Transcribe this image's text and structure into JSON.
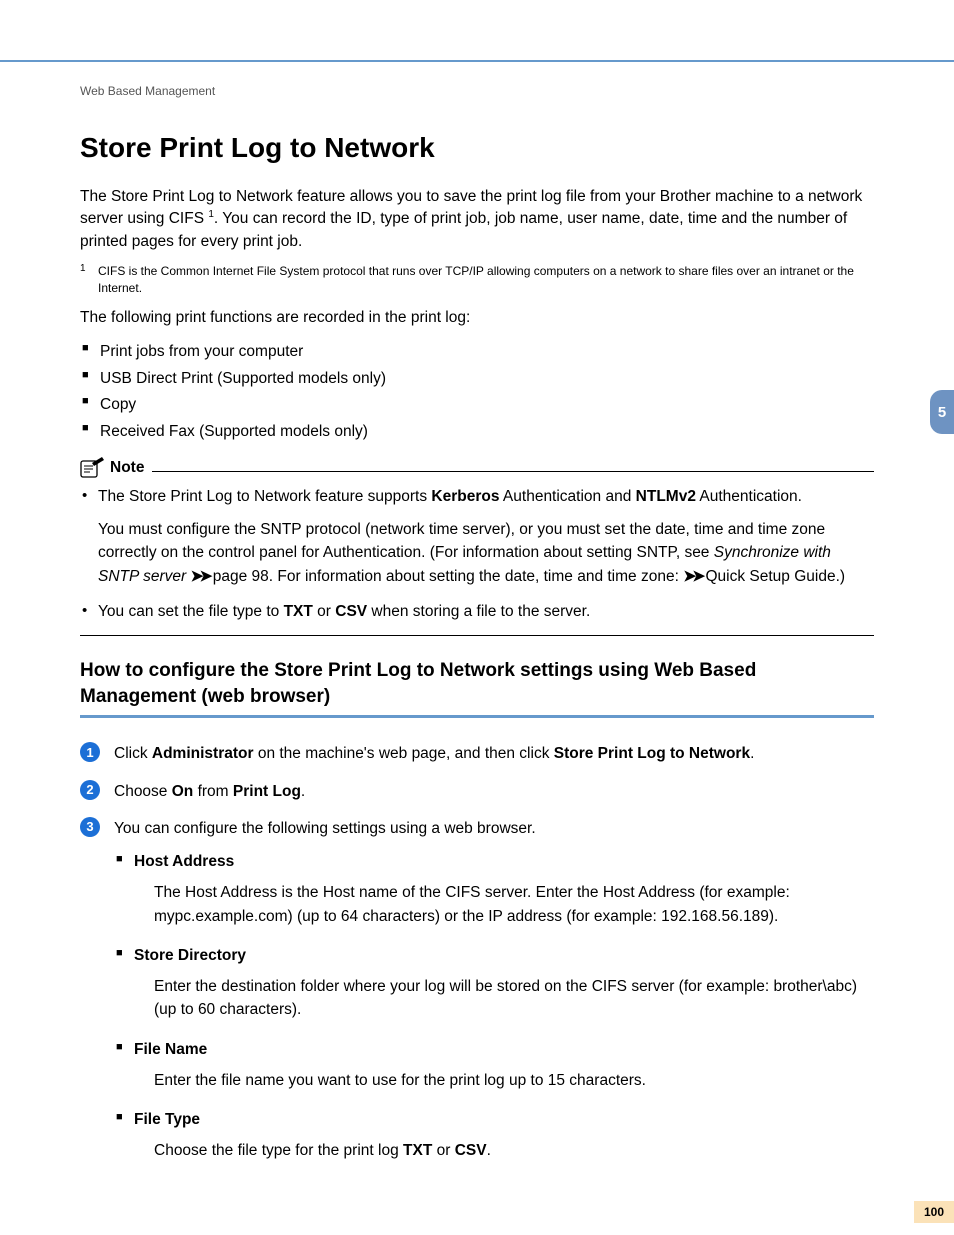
{
  "breadcrumb": "Web Based Management",
  "chapter_tab": "5",
  "h1": "Store Print Log to Network",
  "intro": {
    "p1a": "The Store Print Log to Network feature allows you to save the print log file from your Brother machine to a network server using CIFS ",
    "p1b": ". You can record the ID, type of print job, job name, user name, date, time and the number of printed pages for every print job.",
    "sup1": "1"
  },
  "footnote": {
    "num": "1",
    "text": "CIFS is the Common Internet File System protocol that runs over TCP/IP allowing computers on a network to share files over an intranet or the Internet."
  },
  "p2": "The following print functions are recorded in the print log:",
  "func_list": [
    "Print jobs from your computer",
    "USB Direct Print (Supported models only)",
    "Copy",
    "Received Fax (Supported models only)"
  ],
  "note": {
    "label": "Note",
    "item1": {
      "a": "The Store Print Log to Network feature supports ",
      "b": "Kerberos",
      "c": " Authentication and ",
      "d": "NTLMv2",
      "e": " Authentication."
    },
    "item1_sub": {
      "a": "You must configure the SNTP protocol (network time server), or you must set the date, time and time zone correctly on the control panel for Authentication. (For information about setting SNTP, see ",
      "b": "Synchronize with SNTP server",
      "c": " ",
      "d": " page 98. For information about setting the date, time and time zone: ",
      "e": " Quick Setup Guide.)"
    },
    "item2": {
      "a": "You can set the file type to ",
      "b": "TXT",
      "c": " or ",
      "d": "CSV",
      "e": " when storing a file to the server."
    }
  },
  "h2": "How to configure the Store Print Log to Network settings using Web Based Management (web browser)",
  "steps": {
    "s1": {
      "num": "1",
      "a": "Click ",
      "b": "Administrator",
      "c": " on the machine's web page, and then click ",
      "d": "Store Print Log to Network",
      "e": "."
    },
    "s2": {
      "num": "2",
      "a": "Choose ",
      "b": "On",
      "c": " from ",
      "d": "Print Log",
      "e": "."
    },
    "s3": {
      "num": "3",
      "text": "You can configure the following settings using a web browser."
    }
  },
  "sublist": [
    {
      "title": "Host Address",
      "body": "The Host Address is the Host name of the CIFS server. Enter the Host Address (for example: mypc.example.com) (up to 64 characters) or the IP address (for example: 192.168.56.189)."
    },
    {
      "title": "Store Directory",
      "body": "Enter the destination folder where your log will be stored on the CIFS server (for example: brother\\abc) (up to 60 characters)."
    },
    {
      "title": "File Name",
      "body": "Enter the file name you want to use for the print log up to 15 characters."
    },
    {
      "title": "File Type",
      "body_a": "Choose the file type for the print log ",
      "body_b": "TXT",
      "body_c": " or ",
      "body_d": "CSV",
      "body_e": "."
    }
  ],
  "page_number": "100",
  "arrows": "➤➤"
}
